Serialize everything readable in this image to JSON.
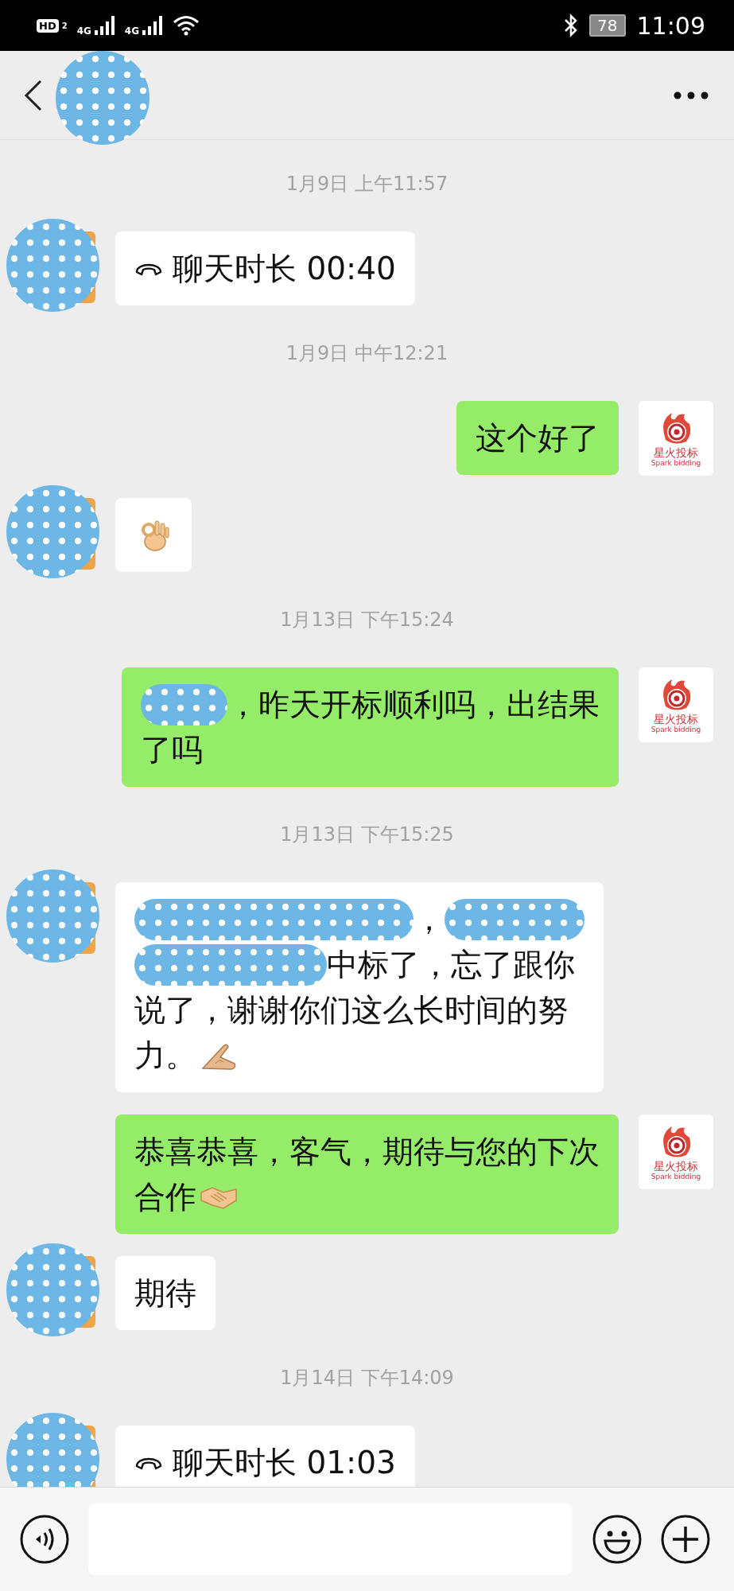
{
  "status_bar": {
    "hd_label": "HD",
    "sim_label": "2",
    "network_labels": [
      "4G",
      "4G"
    ],
    "battery": "78",
    "time": "11:09"
  },
  "messages": [
    {
      "kind": "time",
      "text": "1月9日 上午11:57"
    },
    {
      "kind": "call",
      "outgoing": false,
      "text": "聊天时长 00:40"
    },
    {
      "kind": "time",
      "text": "1月9日 中午12:21"
    },
    {
      "kind": "text",
      "outgoing": true,
      "avatar_title": "星火投标",
      "avatar_subtitle": "Spark bidding",
      "lines": [
        [
          {
            "kind": "text",
            "text": "这个好了"
          }
        ]
      ]
    },
    {
      "kind": "text",
      "outgoing": false,
      "lines": [
        [
          {
            "kind": "ok"
          }
        ]
      ]
    },
    {
      "kind": "time",
      "text": "1月13日 下午15:24"
    },
    {
      "kind": "text",
      "outgoing": true,
      "avatar_title": "星火投标",
      "avatar_subtitle": "Spark bidding",
      "lines": [
        [
          {
            "kind": "redacted"
          },
          {
            "kind": "text",
            "text": "，昨天开标顺利吗，出结果"
          }
        ],
        [
          {
            "kind": "text",
            "text": "了吗"
          }
        ]
      ]
    },
    {
      "kind": "time",
      "text": "1月13日 下午15:25"
    },
    {
      "kind": "text",
      "outgoing": false,
      "lines": [
        [
          {
            "kind": "redacted"
          },
          {
            "kind": "text",
            "text": "，"
          },
          {
            "kind": "redacted"
          }
        ],
        [
          {
            "kind": "redacted"
          },
          {
            "kind": "text",
            "text": "中标了，忘了跟你"
          }
        ],
        [
          {
            "kind": "text",
            "text": "说了，谢谢你们这么长时间的努"
          }
        ],
        [
          {
            "kind": "text",
            "text": "力。"
          },
          {
            "kind": "point"
          }
        ]
      ]
    },
    {
      "kind": "text",
      "outgoing": true,
      "avatar_title": "星火投标",
      "avatar_subtitle": "Spark bidding",
      "lines": [
        [
          {
            "kind": "text",
            "text": "恭喜恭喜，客气，期待与您的下次"
          }
        ],
        [
          {
            "kind": "text",
            "text": "合作"
          },
          {
            "kind": "handshake"
          }
        ]
      ]
    },
    {
      "kind": "text",
      "outgoing": false,
      "lines": [
        [
          {
            "kind": "text",
            "text": "期待"
          }
        ]
      ]
    },
    {
      "kind": "time",
      "text": "1月14日 下午14:09"
    },
    {
      "kind": "call",
      "outgoing": false,
      "text": "聊天时长 01:03"
    }
  ]
}
